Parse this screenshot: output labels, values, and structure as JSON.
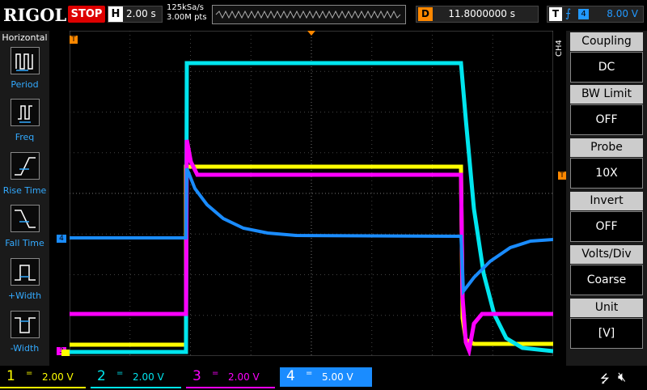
{
  "brand": "RIGOL",
  "run_state": "STOP",
  "horizontal": {
    "label": "H",
    "timebase": "2.00 s",
    "sample_rate": "125kSa/s",
    "memory_depth": "3.00M pts"
  },
  "delay": {
    "label": "D",
    "value": "11.8000000 s"
  },
  "trigger": {
    "label": "T",
    "edge_icon": "rising-edge-icon",
    "source": "4",
    "level": "8.00 V"
  },
  "left_menu": {
    "title": "Horizontal",
    "items": [
      {
        "label": "Period",
        "icon": "period-icon"
      },
      {
        "label": "Freq",
        "icon": "freq-icon"
      },
      {
        "label": "Rise Time",
        "icon": "rise-time-icon"
      },
      {
        "label": "Fall Time",
        "icon": "fall-time-icon"
      },
      {
        "label": "+Width",
        "icon": "pos-width-icon"
      },
      {
        "label": "-Width",
        "icon": "neg-width-icon"
      }
    ]
  },
  "right_menu": {
    "channel_tag": "CH4",
    "items": [
      {
        "label": "Coupling",
        "value": "DC"
      },
      {
        "label": "BW Limit",
        "value": "OFF"
      },
      {
        "label": "Probe",
        "value": "10X"
      },
      {
        "label": "Invert",
        "value": "OFF"
      },
      {
        "label": "Volts/Div",
        "value": "Coarse"
      },
      {
        "label": "Unit",
        "value": "[V]"
      }
    ]
  },
  "markers": {
    "trigger_marker": "T",
    "ch4_marker": "4"
  },
  "channels": [
    {
      "num": "1",
      "coupling": "=",
      "scale": "2.00 V",
      "color": "#ffff00"
    },
    {
      "num": "2",
      "coupling": "=",
      "scale": "2.00 V",
      "color": "#00e5ee"
    },
    {
      "num": "3",
      "coupling": "=",
      "scale": "2.00 V",
      "color": "#ff00ff"
    },
    {
      "num": "4",
      "coupling": "=",
      "scale": "5.00 V",
      "color": "#1a8cff"
    }
  ],
  "colors": {
    "stop": "#dd0000",
    "accent": "#1a8cff",
    "delay": "#ff8800"
  }
}
